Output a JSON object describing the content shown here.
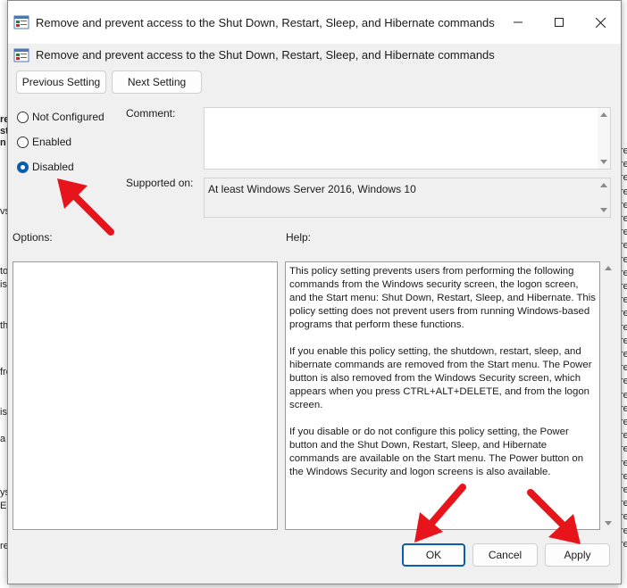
{
  "window": {
    "title": "Remove and prevent access to the Shut Down, Restart, Sleep, and Hibernate commands",
    "header": "Remove and prevent access to the Shut Down, Restart, Sleep, and Hibernate commands"
  },
  "nav": {
    "previous_label": "Previous Setting",
    "next_label": "Next Setting"
  },
  "state": {
    "options": [
      {
        "label": "Not Configured",
        "checked": false
      },
      {
        "label": "Enabled",
        "checked": false
      },
      {
        "label": "Disabled",
        "checked": true
      }
    ]
  },
  "comment": {
    "label": "Comment:",
    "value": ""
  },
  "supported": {
    "label": "Supported on:",
    "value": "At least Windows Server 2016, Windows 10"
  },
  "options_pane": {
    "label": "Options:"
  },
  "help_pane": {
    "label": "Help:",
    "paragraphs": [
      "This policy setting prevents users from performing the following commands from the Windows security screen, the logon screen, and the Start menu: Shut Down, Restart, Sleep, and Hibernate. This policy setting does not prevent users from running Windows-based programs that perform these functions.",
      "If you enable this policy setting, the shutdown, restart, sleep, and hibernate commands are removed from the Start menu. The Power button is also removed from the Windows Security screen, which appears when you press CTRL+ALT+DELETE, and from the logon screen.",
      "If you disable or do not configure this policy setting, the Power button and the Shut Down, Restart, Sleep, and Hibernate commands are available on the Start menu. The Power button on the Windows Security and logon screens is also available."
    ]
  },
  "footer": {
    "ok_label": "OK",
    "cancel_label": "Cancel",
    "apply_label": "Apply"
  },
  "background": {
    "left_fragments": [
      "re",
      "st",
      "n",
      "vs",
      "to",
      "is",
      "th",
      "fro",
      "is",
      "a",
      "ys",
      "ELE",
      "re"
    ],
    "right_fragments": [
      "re",
      "re",
      "re",
      "re",
      "re",
      "re",
      "re",
      "re",
      "re",
      "re",
      "re",
      "re",
      "re",
      "re",
      "re",
      "re",
      "re",
      "re",
      "re",
      "re",
      "re",
      "re",
      "re",
      "re",
      "re",
      "re",
      "re",
      "re",
      "re",
      "re"
    ]
  },
  "colors": {
    "accent": "#0b5cad",
    "annotation_arrow": "#e8141c"
  }
}
